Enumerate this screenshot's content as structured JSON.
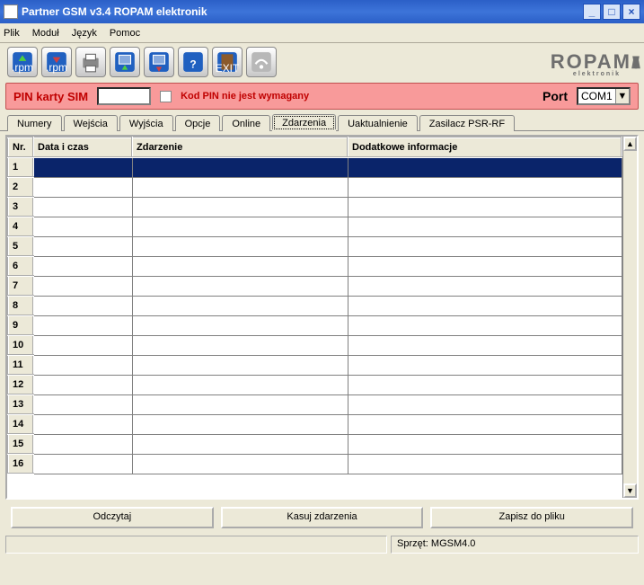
{
  "window": {
    "title": "Partner GSM v3.4 ROPAM elektronik"
  },
  "menu": {
    "items": [
      "Plik",
      "Moduł",
      "Język",
      "Pomoc"
    ]
  },
  "toolbar": {
    "buttons": [
      {
        "name": "open-rpm",
        "label": ".rpm"
      },
      {
        "name": "save-rpm",
        "label": ".rpm"
      },
      {
        "name": "print",
        "label": ""
      },
      {
        "name": "download",
        "label": ""
      },
      {
        "name": "upload",
        "label": ""
      },
      {
        "name": "help",
        "label": "?"
      },
      {
        "name": "exit",
        "label": "EXIT"
      },
      {
        "name": "wireless",
        "label": ""
      }
    ]
  },
  "logo": {
    "brand": "ROPAM",
    "sub": "elektronik"
  },
  "pinbar": {
    "label": "PIN karty SIM",
    "pin_value": "",
    "noreq_label": "Kod PIN nie jest wymagany",
    "noreq_checked": false,
    "port_label": "Port",
    "port_value": "COM1"
  },
  "tabs": [
    "Numery",
    "Wejścia",
    "Wyjścia",
    "Opcje",
    "Online",
    "Zdarzenia",
    "Uaktualnienie",
    "Zasilacz PSR-RF"
  ],
  "tabs_active": 5,
  "table": {
    "columns": [
      "Nr.",
      "Data i czas",
      "Zdarzenie",
      "Dodatkowe informacje"
    ],
    "rows": [
      {
        "nr": "1",
        "data": "",
        "zdarzenie": "",
        "dodatkowe": "",
        "selected": true
      },
      {
        "nr": "2",
        "data": "",
        "zdarzenie": "",
        "dodatkowe": ""
      },
      {
        "nr": "3",
        "data": "",
        "zdarzenie": "",
        "dodatkowe": ""
      },
      {
        "nr": "4",
        "data": "",
        "zdarzenie": "",
        "dodatkowe": ""
      },
      {
        "nr": "5",
        "data": "",
        "zdarzenie": "",
        "dodatkowe": ""
      },
      {
        "nr": "6",
        "data": "",
        "zdarzenie": "",
        "dodatkowe": ""
      },
      {
        "nr": "7",
        "data": "",
        "zdarzenie": "",
        "dodatkowe": ""
      },
      {
        "nr": "8",
        "data": "",
        "zdarzenie": "",
        "dodatkowe": ""
      },
      {
        "nr": "9",
        "data": "",
        "zdarzenie": "",
        "dodatkowe": ""
      },
      {
        "nr": "10",
        "data": "",
        "zdarzenie": "",
        "dodatkowe": ""
      },
      {
        "nr": "11",
        "data": "",
        "zdarzenie": "",
        "dodatkowe": ""
      },
      {
        "nr": "12",
        "data": "",
        "zdarzenie": "",
        "dodatkowe": ""
      },
      {
        "nr": "13",
        "data": "",
        "zdarzenie": "",
        "dodatkowe": ""
      },
      {
        "nr": "14",
        "data": "",
        "zdarzenie": "",
        "dodatkowe": ""
      },
      {
        "nr": "15",
        "data": "",
        "zdarzenie": "",
        "dodatkowe": ""
      },
      {
        "nr": "16",
        "data": "",
        "zdarzenie": "",
        "dodatkowe": ""
      }
    ]
  },
  "buttons": {
    "read": "Odczytaj",
    "clear": "Kasuj zdarzenia",
    "save": "Zapisz do pliku"
  },
  "status": {
    "left": "",
    "right": "Sprzęt: MGSM4.0"
  }
}
